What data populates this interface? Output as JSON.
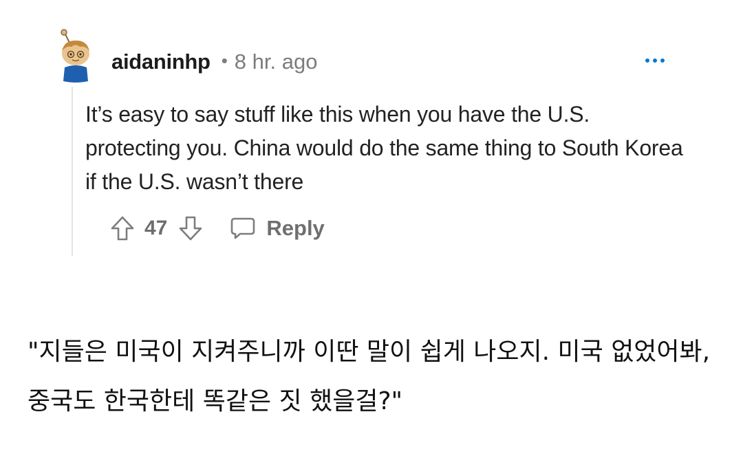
{
  "comment": {
    "username": "aidaninhp",
    "separator": "•",
    "timestamp": "8 hr. ago",
    "body": "It’s easy to say stuff like this when you have the U.S. protecting you. China would do the same thing to South Korea if the U.S. wasn’t there",
    "score": "47",
    "reply_label": "Reply",
    "avatar_icon": "snoo-avatar-icon",
    "more_icon": "ellipsis-icon",
    "upvote_icon": "upvote-arrow-icon",
    "downvote_icon": "downvote-arrow-icon",
    "reply_icon": "speech-bubble-icon"
  },
  "caption": {
    "text": "\"지들은 미국이 지켜주니까 이딴 말이 쉽게 나오지. 미국 없었어봐, 중국도 한국한테 똑같은 짓 했을걸?\""
  },
  "colors": {
    "text_primary": "#1c1c1c",
    "text_muted": "#7c7c7c",
    "accent_blue": "#0079d3",
    "thread_line": "#e3e4e6"
  }
}
